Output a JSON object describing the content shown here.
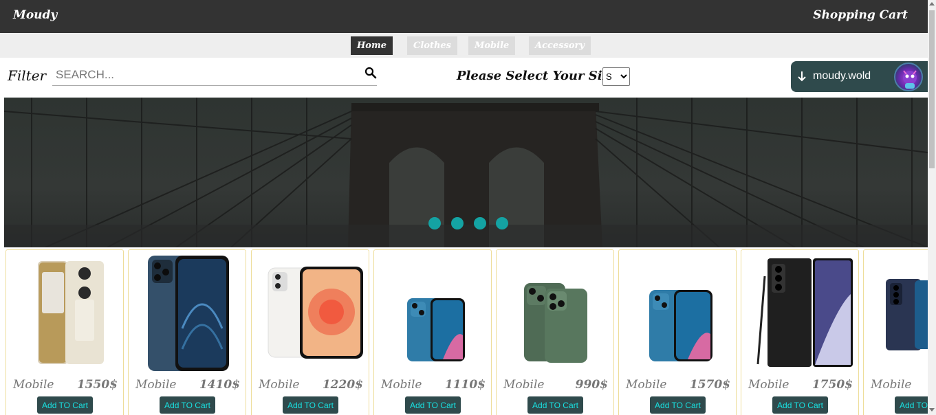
{
  "header": {
    "brand": "Moudy",
    "cart_label": "Shopping Cart"
  },
  "nav": {
    "tabs": [
      {
        "label": "Home",
        "active": true
      },
      {
        "label": "Clothes",
        "active": false
      },
      {
        "label": "Mobile",
        "active": false
      },
      {
        "label": "Accessory",
        "active": false
      }
    ]
  },
  "filter": {
    "label": "Filter",
    "search_placeholder": "SEARCH...",
    "search_value": "",
    "size_label": "Please Select Your Size :",
    "size_selected": "S"
  },
  "user": {
    "name": "moudy.wold",
    "icon": "arrow-down-icon"
  },
  "slider": {
    "dot_count": 4,
    "dot_color": "#14a3a3"
  },
  "products": [
    {
      "category": "Mobile",
      "price": "1550$",
      "button": "Add TO Cart",
      "phone": "huawei-gold"
    },
    {
      "category": "Mobile",
      "price": "1410$",
      "button": "Add TO Cart",
      "phone": "iphone12pro-blue"
    },
    {
      "category": "Mobile",
      "price": "1220$",
      "button": "Add TO Cart",
      "phone": "iphone12-white"
    },
    {
      "category": "Mobile",
      "price": "1110$",
      "button": "Add TO Cart",
      "phone": "iphone13-blue-small"
    },
    {
      "category": "Mobile",
      "price": "990$",
      "button": "Add TO Cart",
      "phone": "iphone13pro-green"
    },
    {
      "category": "Mobile",
      "price": "1570$",
      "button": "Add TO Cart",
      "phone": "iphone13-blue"
    },
    {
      "category": "Mobile",
      "price": "1750$",
      "button": "Add TO Cart",
      "phone": "note20-black"
    },
    {
      "category": "Mobile",
      "price": "",
      "button": "Add TO Cart",
      "phone": "s20fe-navy"
    }
  ],
  "colors": {
    "header_bg": "#333333",
    "accent": "#2f4a4c",
    "button_text": "#19e0e0",
    "card_border": "#eedd99"
  }
}
